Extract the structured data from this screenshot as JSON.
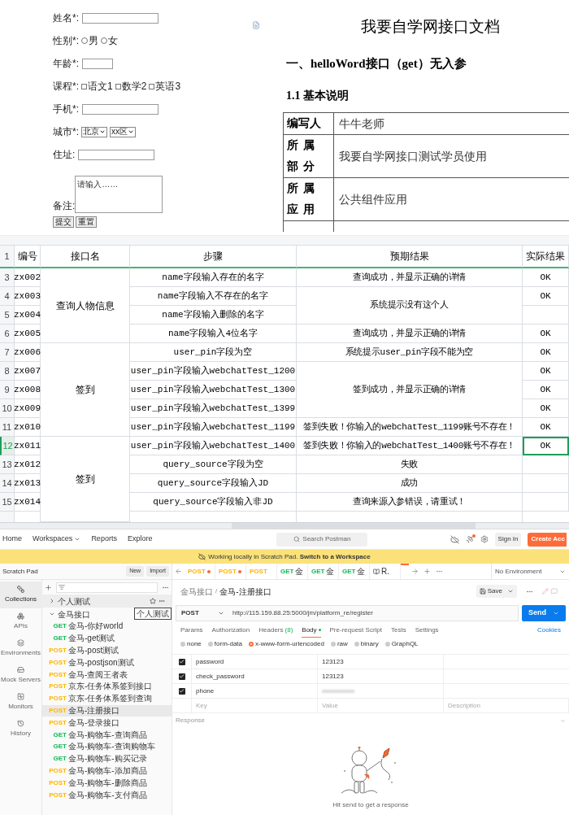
{
  "form": {
    "fields": [
      {
        "kind": "text",
        "label": "姓名*:"
      },
      {
        "kind": "radio",
        "label": "性别*:",
        "options": [
          {
            "label": "男",
            "selected": false
          },
          {
            "label": "女",
            "selected": false
          }
        ]
      },
      {
        "kind": "short_text",
        "label": "年龄*:"
      },
      {
        "kind": "checkbox",
        "label": "课程*:",
        "options": [
          {
            "label": "语文1",
            "checked": false
          },
          {
            "label": "数学2",
            "checked": false
          },
          {
            "label": "英语3",
            "checked": false
          }
        ]
      },
      {
        "kind": "text",
        "label": "手机*:"
      },
      {
        "kind": "select",
        "label": "城市*:",
        "options": [
          "北京",
          "xx区"
        ]
      },
      {
        "kind": "text",
        "label": "住址:"
      },
      {
        "kind": "textarea",
        "label": "备注:",
        "placeholder": "请输入……"
      }
    ],
    "buttons": [
      "提交",
      "重置"
    ]
  },
  "document": {
    "title": "我要自学网接口文档",
    "heading": "一、helloWord接口（get）无入参",
    "subheading": "1.1 基本说明",
    "table": [
      [
        "编写人",
        "牛牛老师"
      ],
      [
        "所属部分",
        "我要自学网接口测试学员使用"
      ],
      [
        "所属应用",
        "公共组件应用"
      ]
    ]
  },
  "sheet": {
    "header_row": "1",
    "columns": [
      "编号",
      "接口名",
      "步骤",
      "预期结果",
      "实际结果"
    ],
    "groups": [
      {
        "name": "查询人物信息",
        "items": [
          {
            "expected": "查询成功，并显示正确的详情",
            "rows": [
              {
                "num": "3",
                "id": "zx002",
                "step": "name字段输入存在的名字",
                "actual": "OK",
                "selected": false
              }
            ]
          },
          {
            "expected": "系统提示没有这个人",
            "rows": [
              {
                "num": "4",
                "id": "zx003",
                "step": "name字段输入不存在的名字",
                "actual": "OK",
                "selected": false
              },
              {
                "num": "5",
                "id": "zx004",
                "step": "name字段输入删除的名字",
                "actual": "",
                "selected": false
              }
            ]
          },
          {
            "expected": "查询成功，并显示正确的详情",
            "rows": [
              {
                "num": "6",
                "id": "zx005",
                "step": "name字段输入4位名字",
                "actual": "OK",
                "selected": false
              }
            ]
          }
        ]
      },
      {
        "name": "签到",
        "items": [
          {
            "expected": "系统提示user_pin字段不能为空",
            "rows": [
              {
                "num": "7",
                "id": "zx006",
                "step": "user_pin字段为空",
                "actual": "OK",
                "selected": false
              }
            ]
          },
          {
            "expected": "签到成功，并显示正确的详情",
            "rows": [
              {
                "num": "8",
                "id": "zx007",
                "step": "user_pin字段输入webchatTest_1200",
                "actual": "OK",
                "selected": false
              },
              {
                "num": "9",
                "id": "zx008",
                "step": "user_pin字段输入webchatTest_1300",
                "actual": "OK",
                "selected": false
              },
              {
                "num": "10",
                "id": "zx009",
                "step": "user_pin字段输入webchatTest_1399",
                "actual": "OK",
                "selected": false
              }
            ]
          },
          {
            "expected": "签到失败！你输入的webchatTest_1199账号不存在！",
            "rows": [
              {
                "num": "11",
                "id": "zx010",
                "step": "user_pin字段输入webchatTest_1199",
                "actual": "OK",
                "selected": false
              }
            ]
          }
        ]
      },
      {
        "name": "签到",
        "items": [
          {
            "expected": "签到失败！你输入的webchatTest_1400账号不存在！",
            "rows": [
              {
                "num": "12",
                "id": "zx011",
                "step": "user_pin字段输入webchatTest_1400",
                "actual": "OK",
                "selected": true
              }
            ]
          },
          {
            "expected": "失败",
            "rows": [
              {
                "num": "13",
                "id": "zx012",
                "step": "query_source字段为空",
                "actual": "",
                "selected": false
              }
            ]
          },
          {
            "expected": "成功",
            "rows": [
              {
                "num": "14",
                "id": "zx013",
                "step": "query_source字段输入JD",
                "actual": "",
                "selected": false
              }
            ]
          },
          {
            "expected": "查询来源入参错误，请重试！",
            "rows": [
              {
                "num": "15",
                "id": "zx014",
                "step": "query_source字段输入非JD",
                "actual": "",
                "selected": false
              }
            ]
          }
        ]
      }
    ]
  },
  "postman": {
    "nav": [
      {
        "label": "Home",
        "menu": false
      },
      {
        "label": "Workspaces",
        "menu": true
      },
      {
        "label": "Reports",
        "menu": false
      },
      {
        "label": "Explore",
        "menu": false
      }
    ],
    "search": {
      "placeholder": "Search Postman"
    },
    "notification": true,
    "sign_in": "Sign In",
    "create_account": "Create Acc",
    "banner": "Working locally in Scratch Pad. **Switch to a Workspace**",
    "sidebar": {
      "title": "Scratch Pad",
      "buttons": [
        "New",
        "Import"
      ],
      "rail": [
        {
          "label": "Collections",
          "selected": true
        },
        {
          "label": "APIs",
          "selected": false
        },
        {
          "label": "Environments",
          "selected": false
        },
        {
          "label": "Mock Servers",
          "selected": false
        },
        {
          "label": "Monitors",
          "selected": false
        },
        {
          "label": "History",
          "selected": false
        }
      ],
      "tree": [
        {
          "label": "个人测试",
          "expanded": false,
          "tooltip": "个人测试"
        },
        {
          "label": "金马接口",
          "expanded": true,
          "children": [
            {
              "method": "GET",
              "label": "金马-你好world",
              "selected": false
            },
            {
              "method": "GET",
              "label": "金马-get测试",
              "selected": false
            },
            {
              "method": "POST",
              "label": "金马-post测试",
              "selected": false
            },
            {
              "method": "POST",
              "label": "金马-postjson测试",
              "selected": false
            },
            {
              "method": "POST",
              "label": "金马-查阅王者表",
              "selected": false
            },
            {
              "method": "POST",
              "label": "京东-任务体系签到接口",
              "selected": false
            },
            {
              "method": "POST",
              "label": "京东-任务体系签到查询",
              "selected": false
            },
            {
              "method": "POST",
              "label": "金马-注册接口",
              "selected": true
            },
            {
              "method": "POST",
              "label": "金马-登录接口",
              "selected": false
            },
            {
              "method": "GET",
              "label": "金马-购物车-查询商品",
              "selected": false
            },
            {
              "method": "GET",
              "label": "金马-购物车-查询购物车",
              "selected": false
            },
            {
              "method": "GET",
              "label": "金马-购物车-购买记录",
              "selected": false
            },
            {
              "method": "POST",
              "label": "金马-购物车-添加商品",
              "selected": false
            },
            {
              "method": "POST",
              "label": "金马-购物车-删除商品",
              "selected": false
            },
            {
              "method": "POST",
              "label": "金马-购物车-支付商品",
              "selected": false
            }
          ]
        }
      ]
    },
    "tabs": [
      {
        "kind": "request",
        "method": "POST",
        "unsaved": true
      },
      {
        "kind": "request",
        "method": "POST",
        "unsaved": true
      },
      {
        "kind": "request",
        "method": "POST",
        "unsaved": false
      },
      {
        "kind": "request",
        "method": "GET",
        "label": "金",
        "unsaved": false
      },
      {
        "kind": "request",
        "method": "GET",
        "label": "金",
        "unsaved": false
      },
      {
        "kind": "request",
        "method": "GET",
        "label": "金",
        "unsaved": false
      },
      {
        "kind": "doc",
        "label": "R.",
        "unsaved": false
      }
    ],
    "environment": "No Environment",
    "breadcrumb": [
      "金马接口",
      "金马-注册接口"
    ],
    "breadcrumb_separator": "/",
    "save": "Save",
    "request": {
      "method": "POST",
      "url": "http://115.159.88.25:5000/jm/platform_re/register",
      "send": "Send"
    },
    "subtabs": [
      {
        "label": "Params",
        "selected": false
      },
      {
        "label": "Authorization",
        "selected": false
      },
      {
        "label": "Headers",
        "count": "(8)",
        "selected": false
      },
      {
        "label": "Body",
        "dot": true,
        "selected": true
      },
      {
        "label": "Pre-request Script",
        "selected": false
      },
      {
        "label": "Tests",
        "selected": false
      },
      {
        "label": "Settings",
        "selected": false
      }
    ],
    "cookies": "Cookies",
    "body_types": [
      {
        "label": "none",
        "selected": false
      },
      {
        "label": "form-data",
        "selected": false
      },
      {
        "label": "x-www-form-urlencoded",
        "selected": true
      },
      {
        "label": "raw",
        "selected": false
      },
      {
        "label": "binary",
        "selected": false
      },
      {
        "label": "GraphQL",
        "selected": false
      }
    ],
    "params": [
      {
        "key": "password",
        "value": "123123",
        "checked": true,
        "blurred": false
      },
      {
        "key": "check_password",
        "value": "123123",
        "checked": true,
        "blurred": false
      },
      {
        "key": "phone",
        "checked": true,
        "blurred": true
      }
    ],
    "param_placeholders": [
      "Key",
      "Value",
      "Description"
    ],
    "response": {
      "label": "Response",
      "hint": "Hit send to get a response"
    }
  }
}
